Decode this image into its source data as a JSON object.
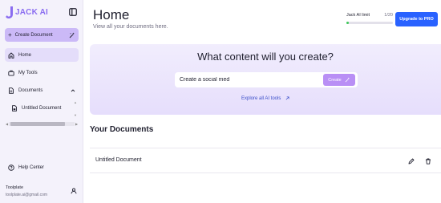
{
  "sidebar": {
    "brand": "JACK AI",
    "create_label": "Create Document",
    "items": [
      {
        "label": "Home"
      },
      {
        "label": "My Tools"
      },
      {
        "label": "Documents"
      },
      {
        "label": "Untitled Document"
      }
    ],
    "help_label": "Help Center",
    "user_name": "Toolplate",
    "user_email": "toolplate.ai@gmail.com"
  },
  "header": {
    "title": "Home",
    "subtitle": "View all your documents here.",
    "limit_label": "Jack AI limit",
    "limit_count": "1/20",
    "limit_fraction": 0.05,
    "upgrade_label": "Upgrade to PRO"
  },
  "hero": {
    "title": "What content will you create?",
    "input_value": "Create a social med",
    "create_label": "Create",
    "link_label": "Explore all AI tools"
  },
  "documents": {
    "section_title": "Your Documents",
    "rows": [
      {
        "name": "Untitled Document"
      }
    ]
  },
  "colors": {
    "accent": "#b98ff5",
    "primary_button": "#2962ff",
    "sidebar_bg": "#f4f2fb",
    "limit_fill": "#3ec95a"
  },
  "icons": {
    "logo": "jack-logo-icon",
    "collapse": "sidebar-collapse-icon",
    "create_doc": "magic-sparkle-icon",
    "home": "home-icon",
    "tools": "briefcase-icon",
    "documents": "document-icon",
    "help": "help-circle-icon",
    "user": "user-icon",
    "edit": "pencil-icon",
    "delete": "trash-icon",
    "external": "arrow-up-right-icon"
  }
}
